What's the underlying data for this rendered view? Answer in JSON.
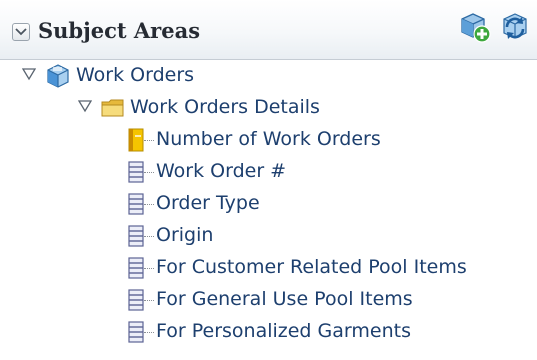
{
  "header": {
    "title": "Subject Areas",
    "collapse_icon": "chevron-down-icon",
    "actions": [
      {
        "name": "add-subject-area",
        "icon": "cube-plus-icon"
      },
      {
        "name": "refresh",
        "icon": "refresh-icon"
      }
    ]
  },
  "tree": {
    "root": {
      "label": "Work Orders",
      "icon": "subject-area-cube-icon",
      "expanded": true,
      "folder": {
        "label": "Work Orders Details",
        "icon": "folder-icon",
        "expanded": true,
        "items": [
          {
            "label": "Number of Work Orders",
            "type": "measure"
          },
          {
            "label": "Work Order #",
            "type": "attribute"
          },
          {
            "label": "Order Type",
            "type": "attribute"
          },
          {
            "label": "Origin",
            "type": "attribute"
          },
          {
            "label": "For Customer Related Pool Items",
            "type": "attribute"
          },
          {
            "label": "For General Use Pool Items",
            "type": "attribute"
          },
          {
            "label": "For Personalized Garments",
            "type": "attribute"
          }
        ]
      }
    }
  },
  "colors": {
    "label": "#1d3f6e",
    "measure_icon": "#f5c400",
    "attribute_icon": "#8e95c4",
    "folder": "#f2d46a",
    "cube": "#4a93d6",
    "add_badge": "#3ea83e"
  }
}
